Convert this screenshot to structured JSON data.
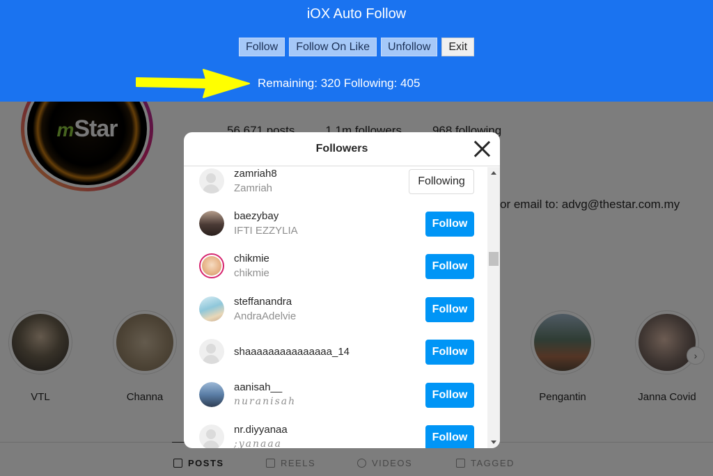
{
  "colors": {
    "extension_bar": "#1a73f0",
    "follow_button": "#0095f6",
    "arrow": "#ffff00",
    "story_ring": "#d6246e"
  },
  "extension": {
    "title": "iOX Auto Follow",
    "buttons": {
      "follow": "Follow",
      "follow_on_like": "Follow On Like",
      "unfollow": "Unfollow",
      "exit": "Exit"
    },
    "status": "Remaining: 320 Following: 405"
  },
  "profile": {
    "logo_text": "Star",
    "logo_prefix": "m",
    "stats": {
      "posts": "56,671 posts",
      "followers": "1.1m followers",
      "following": "968 following"
    },
    "contact": "or email to: advg@thestar.com.my",
    "highlights": [
      {
        "label": "VTL",
        "color": "#6d6250"
      },
      {
        "label": "Channa",
        "color": "#9d8a6e"
      },
      {
        "label": "Pengantin",
        "color": "#5f7a6a"
      },
      {
        "label": "Janna Covid",
        "color": "#806e66"
      }
    ],
    "tabs": {
      "posts": "POSTS",
      "reels": "REELS",
      "videos": "VIDEOS",
      "tagged": "TAGGED"
    }
  },
  "modal": {
    "title": "Followers",
    "followers": [
      {
        "username": "zamriah8",
        "full_name": "Zamriah",
        "button": "Following",
        "avatar": "blank"
      },
      {
        "username": "baezybay",
        "full_name": "IFTI EZZYLIA",
        "button": "Follow",
        "avatar": "photo",
        "avatar_color": "#4a3a35"
      },
      {
        "username": "chikmie",
        "full_name": "chikmie",
        "button": "Follow",
        "avatar": "story",
        "avatar_color": "#e7b58a"
      },
      {
        "username": "steffanandra",
        "full_name": "AndraAdelvie",
        "button": "Follow",
        "avatar": "photo",
        "avatar_color": "#8fc7da"
      },
      {
        "username": "shaaaaaaaaaaaaaaa_14",
        "full_name": "",
        "button": "Follow",
        "avatar": "blank"
      },
      {
        "username": "aanisah__",
        "full_name": "nuranisah",
        "button": "Follow",
        "avatar": "photo",
        "avatar_color": "#5a7ea6"
      },
      {
        "username": "nr.diyyanaa",
        "full_name": ";yanaaa",
        "button": "Follow",
        "avatar": "blank"
      }
    ]
  }
}
